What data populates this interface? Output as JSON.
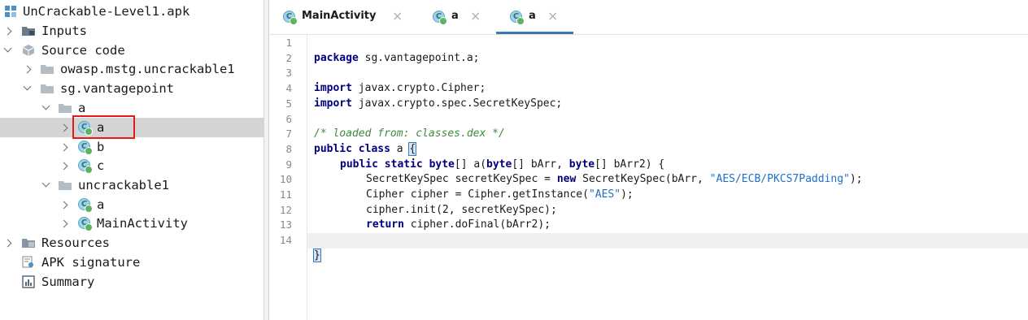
{
  "tree": {
    "root": "UnCrackable-Level1.apk",
    "inputs": "Inputs",
    "source_code": "Source code",
    "pkg_owasp": "owasp.mstg.uncrackable1",
    "pkg_sg": "sg.vantagepoint",
    "pkg_a": "a",
    "class_a": "a",
    "class_b": "b",
    "class_c": "c",
    "pkg_uncrackable1": "uncrackable1",
    "class_a2": "a",
    "class_main": "MainActivity",
    "resources": "Resources",
    "apk_signature": "APK signature",
    "summary": "Summary"
  },
  "tabs": [
    {
      "label": "MainActivity"
    },
    {
      "label": "a"
    },
    {
      "label": "a"
    }
  ],
  "tab_close": "×",
  "line_numbers": [
    "1",
    "2",
    "3",
    "4",
    "5",
    "6",
    "7",
    "8",
    "9",
    "10",
    "11",
    "12",
    "13",
    "14"
  ],
  "code": {
    "l1_kw": "package",
    "l1_rest": " sg.vantagepoint.a;",
    "l3_kw": "import",
    "l3_rest": " javax.crypto.Cipher;",
    "l4_kw": "import",
    "l4_rest": " javax.crypto.spec.SecretKeySpec;",
    "l6_cmt": "/* loaded from: classes.dex */",
    "l7_kw": "public class",
    "l7_rest": " a ",
    "l7_brace": "{",
    "l8_kw1": "public static",
    "l8_a": " ",
    "l8_kw2": "byte",
    "l8_b": "[] a(",
    "l8_kw3": "byte",
    "l8_c": "[] bArr, ",
    "l8_kw4": "byte",
    "l8_d": "[] bArr2) {",
    "l9_a": "SecretKeySpec secretKeySpec = ",
    "l9_kw": "new",
    "l9_b": " SecretKeySpec(bArr, ",
    "l9_str": "\"AES/ECB/PKCS7Padding\"",
    "l9_c": ");",
    "l10_a": "Cipher cipher = Cipher.getInstance(",
    "l10_str": "\"AES\"",
    "l10_b": ");",
    "l11_a": "cipher.init(",
    "l11_num": "2",
    "l11_b": ", secretKeySpec);",
    "l12_kw": "return",
    "l12_rest": " cipher.doFinal(bArr2);",
    "l13": "}",
    "l14": "}"
  }
}
